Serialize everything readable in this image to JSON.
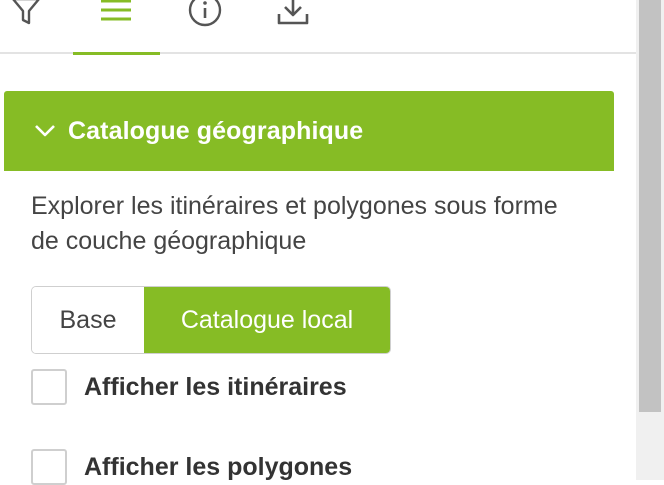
{
  "toolbar": {
    "tabs": [
      {
        "icon": "filter-icon"
      },
      {
        "icon": "menu-icon",
        "active": true
      },
      {
        "icon": "info-icon"
      },
      {
        "icon": "download-icon"
      }
    ]
  },
  "panel": {
    "title": "Catalogue géographique",
    "expanded": true,
    "description": "Explorer les itinéraires et polygones sous forme de couche géographique"
  },
  "source_toggle": {
    "options": [
      "Base",
      "Catalogue local"
    ],
    "selected": "Catalogue local"
  },
  "options": {
    "show_routes": {
      "label": "Afficher les itinéraires",
      "checked": false
    },
    "show_polygons": {
      "label": "Afficher les polygones",
      "checked": false
    }
  },
  "colors": {
    "accent": "#86bc25",
    "text": "#444444",
    "icon": "#555555"
  }
}
